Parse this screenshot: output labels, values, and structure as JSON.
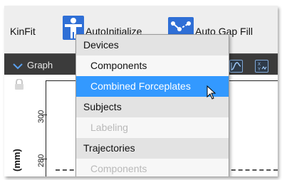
{
  "toolbar": {
    "kinfit_label": "KinFit",
    "autoinitialize_label": "AutoInitialize",
    "autogapfill_label": "Auto Gap Fill",
    "autoinitialize_icon": "person-icon",
    "autogapfill_icon": "gap-fill-icon"
  },
  "graph_panel": {
    "title": "Graph",
    "collapse_icon": "chevron-down-icon"
  },
  "plot": {
    "ylabel": "(mm)",
    "tick_labels": [
      "300",
      "280"
    ],
    "lock_icon": "lock-icon"
  },
  "menu": {
    "items": [
      {
        "label": "Devices",
        "kind": "header"
      },
      {
        "label": "Components",
        "kind": "normal"
      },
      {
        "label": "Combined Forceplates",
        "kind": "selected"
      },
      {
        "label": "Subjects",
        "kind": "header"
      },
      {
        "label": "Labeling",
        "kind": "disabled"
      },
      {
        "label": "Trajectories",
        "kind": "header"
      },
      {
        "label": "Components",
        "kind": "disabled"
      }
    ]
  },
  "colors": {
    "selection": "#3399ff",
    "toolbar_bg": "#eeeeee",
    "graphbar_bg": "#3b3b3b",
    "icon_blue": "#2f6fd6"
  }
}
